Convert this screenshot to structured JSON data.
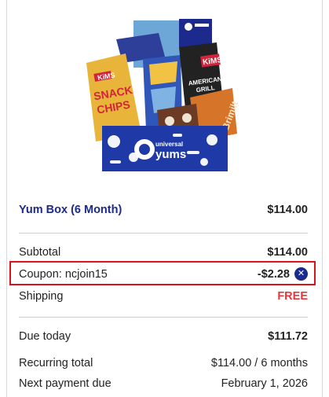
{
  "product": {
    "name": "Yum Box (6 Month)",
    "price": "$114.00",
    "image_alt": "Universal Yums box with snacks"
  },
  "summary": {
    "subtotal_label": "Subtotal",
    "subtotal_value": "$114.00",
    "coupon_label": "Coupon: ncjoin15",
    "coupon_value": "-$2.28",
    "coupon_remove_glyph": "✕",
    "shipping_label": "Shipping",
    "shipping_value": "FREE",
    "due_today_label": "Due today",
    "due_today_value": "$111.72",
    "recurring_label": "Recurring total",
    "recurring_value": "$114.00 / 6 months",
    "next_payment_label": "Next payment due",
    "next_payment_value": "February 1, 2026"
  },
  "colors": {
    "brand_blue": "#1b2a8c",
    "free_red": "#e5373b",
    "highlight_red": "#d8131b"
  }
}
